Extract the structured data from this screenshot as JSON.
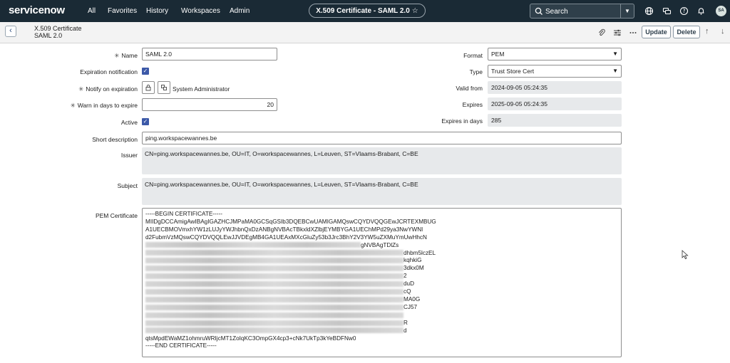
{
  "nav": {
    "logo": "servicenow",
    "menu": [
      "All",
      "Favorites",
      "History",
      "Workspaces",
      "Admin"
    ],
    "record_pill": "X.509 Certificate - SAML 2.0",
    "search_placeholder": "Search",
    "avatar_initials": "SA"
  },
  "header": {
    "title_line1": "X.509 Certificate",
    "title_line2": "SAML 2.0",
    "update_label": "Update",
    "delete_label": "Delete"
  },
  "form": {
    "name_label": "Name",
    "name_value": "SAML 2.0",
    "expiration_label": "Expiration notification",
    "expiration_checked": true,
    "notify_label": "Notify on expiration",
    "notify_value": "System Administrator",
    "warn_label": "Warn in days to expire",
    "warn_value": "20",
    "active_label": "Active",
    "active_checked": true,
    "format_label": "Format",
    "format_value": "PEM",
    "type_label": "Type",
    "type_value": "Trust Store Cert",
    "valid_from_label": "Valid from",
    "valid_from_value": "2024-09-05 05:24:35",
    "expires_label": "Expires",
    "expires_value": "2025-09-05 05:24:35",
    "expires_days_label": "Expires in days",
    "expires_days_value": "285",
    "short_desc_label": "Short description",
    "short_desc_value": "ping.workspacewannes.be",
    "issuer_label": "Issuer",
    "issuer_value": "CN=ping.workspacewannes.be, OU=IT, O=workspacewannes, L=Leuven, ST=Vlaams-Brabant, C=BE",
    "subject_label": "Subject",
    "subject_value": "CN=ping.workspacewannes.be, OU=IT, O=workspacewannes, L=Leuven, ST=Vlaams-Brabant, C=BE",
    "pem_label": "PEM Certificate",
    "pem_lines": [
      "-----BEGIN CERTIFICATE-----",
      "MIIDgDCCAmigAwIBAgIGAZHCJMPaMA0GCSqGSIb3DQEBCwUAMIGAMQswCQYDVQQGEwJCRTEXMBUG",
      "A1UECBMOVmxhYW1zLUJyYWJhbnQxDzANBgNVBAcTBkxldXZlbjEYMBYGA1UEChMPd29ya3NwYWNl",
      "d2FubmVzMQswCQYDVQQLEwJJVDEgMB4GA1UEAxMXcGluZy53b3Jrc3BhY2V3YW5uZXMuYmUwHhcN"
    ],
    "pem_tails": [
      "gNVBAgTDlZs",
      "dhbm5lczEL",
      "kqhkiG",
      "3dkx0M",
      "2",
      "duD",
      "cQ",
      "MA0G",
      "CJ57",
      "",
      "R",
      "d"
    ],
    "pem_last_line": "qtsMpdEWaMZ1ohmruWRIjcMT1ZoIqKC3OmpGX4cp3+cNk7UkTp3kYeBDFNw0",
    "pem_end": "-----END CERTIFICATE-----"
  }
}
